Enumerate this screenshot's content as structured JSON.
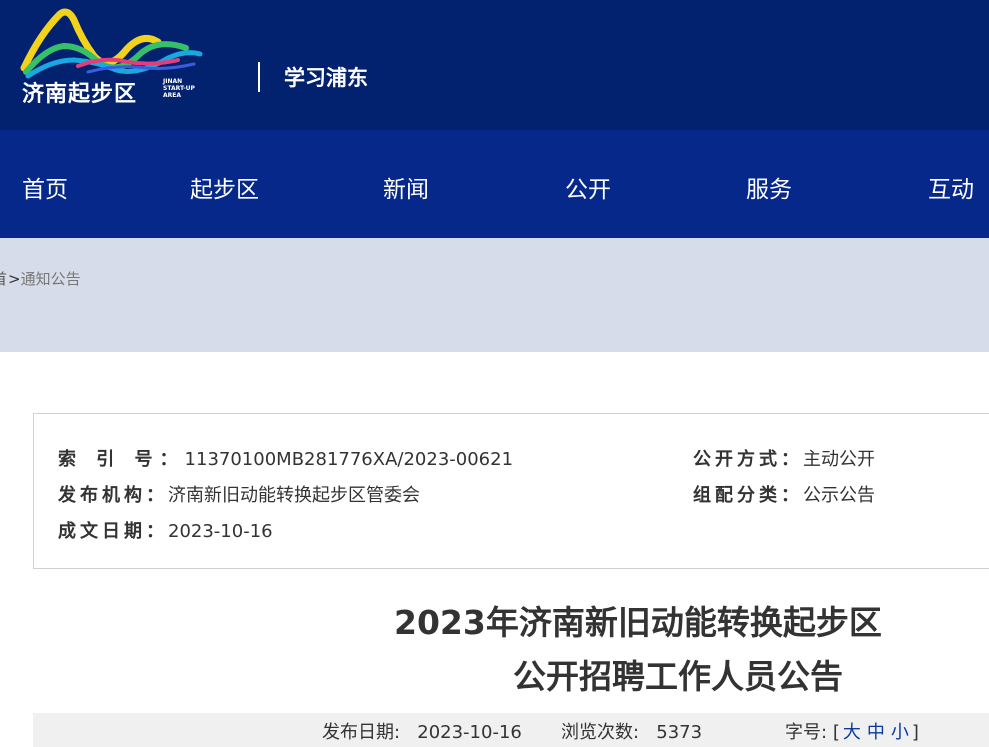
{
  "header": {
    "logo_cn": "济南起步区",
    "logo_en": [
      "JINAN",
      "START-UP",
      "AREA"
    ],
    "study_link": "学习浦东"
  },
  "nav": {
    "items": [
      "首页",
      "起步区",
      "新闻",
      "公开",
      "服务",
      "互动"
    ]
  },
  "breadcrumb": {
    "home": "首页",
    "separator": ">",
    "current": "通知公告"
  },
  "info": {
    "index_label": "索 引 号",
    "index_value": "11370100MB281776XA/2023-00621",
    "agency_label": "发布机构",
    "agency_value": "济南新旧动能转换起步区管委会",
    "date_label": "成文日期",
    "date_value": "2023-10-16",
    "method_label": "公开方式",
    "method_value": "主动公开",
    "category_label": "组配分类",
    "category_value": "公示公告",
    "colon": "："
  },
  "article": {
    "title_line1": "2023年济南新旧动能转换起步区",
    "title_line2": "公开招聘工作人员公告"
  },
  "meta": {
    "publish_label": "发布日期:",
    "publish_date": "2023-10-16",
    "views_label": "浏览次数:",
    "views_count": "5373",
    "font_label": "字号:",
    "bracket_open": "[",
    "size_large": "大",
    "size_medium": "中",
    "size_small": "小",
    "bracket_close": "]"
  },
  "colors": {
    "header_bg": "#02226f",
    "nav_bg": "#05288a",
    "crumb_bg": "#d6dcea",
    "link_blue": "#0a3aa0"
  }
}
